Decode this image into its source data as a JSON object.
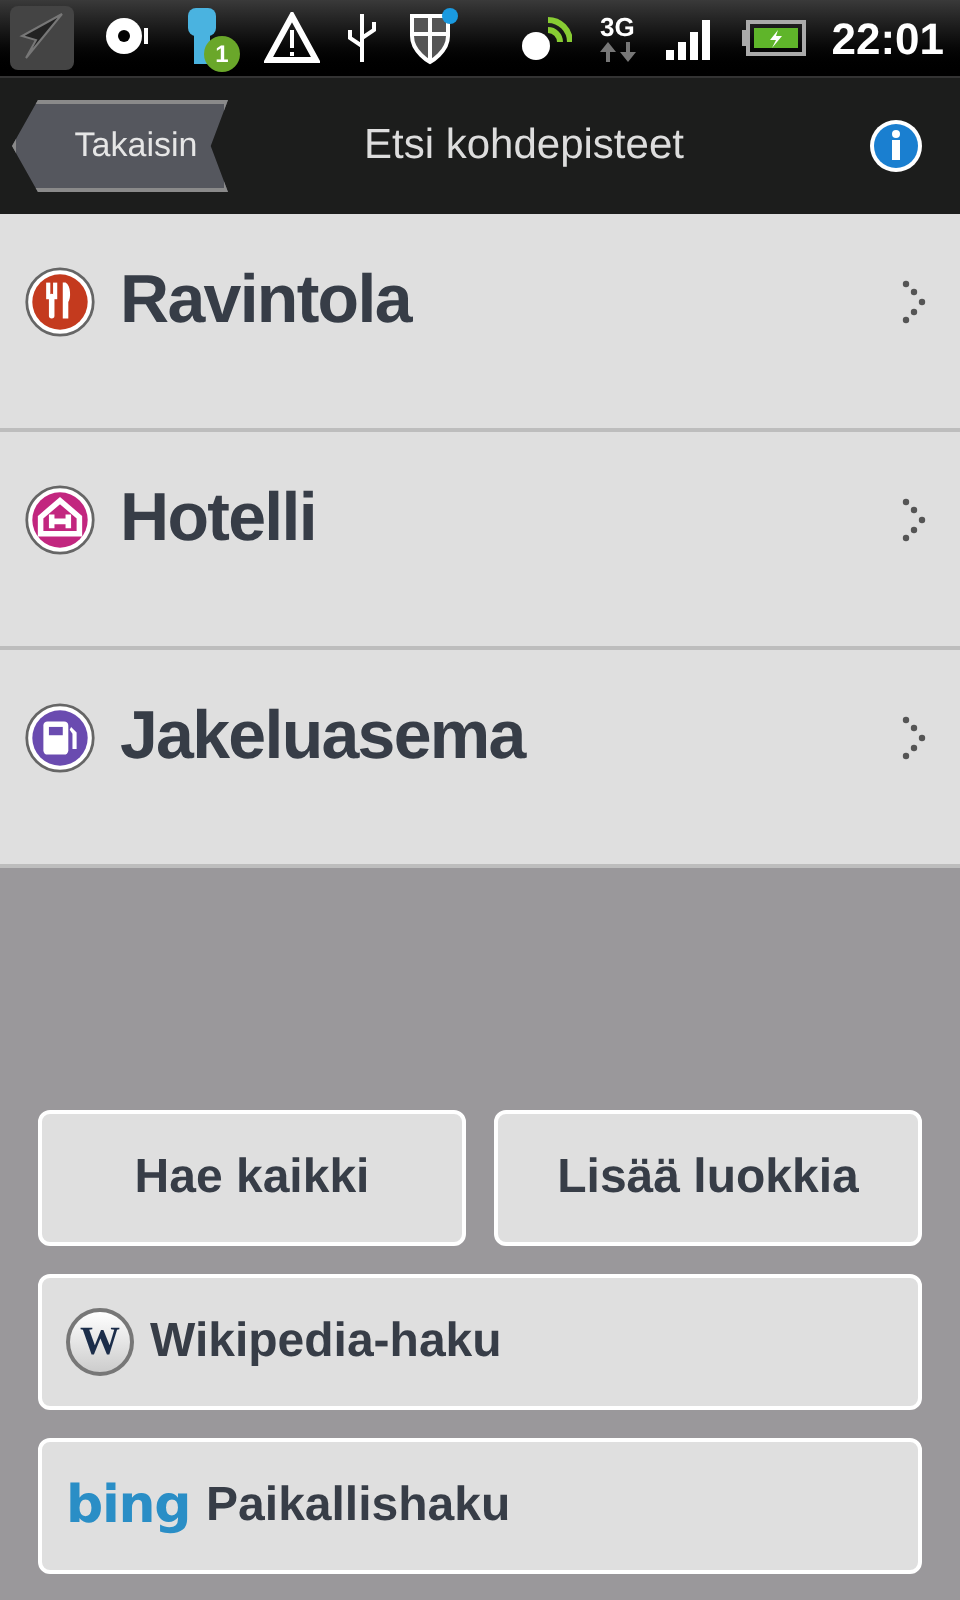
{
  "status_bar": {
    "notification_badge": "1",
    "network": "3G",
    "time": "22:01"
  },
  "header": {
    "back": "Takaisin",
    "title": "Etsi kohdepisteet"
  },
  "categories": [
    {
      "label": "Ravintola",
      "kind": "restaurant",
      "color": "#c43a1e"
    },
    {
      "label": "Hotelli",
      "kind": "hotel",
      "color": "#c2267f"
    },
    {
      "label": "Jakeluasema",
      "kind": "fuel",
      "color": "#6a4bb0"
    }
  ],
  "actions": [
    "Hae kaikki",
    "Lisää luokkia"
  ],
  "searches": [
    {
      "kind": "wikipedia",
      "logo": "W",
      "label": "Wikipedia-haku"
    },
    {
      "kind": "bing",
      "logo": "bing",
      "label": "Paikallishaku"
    }
  ]
}
